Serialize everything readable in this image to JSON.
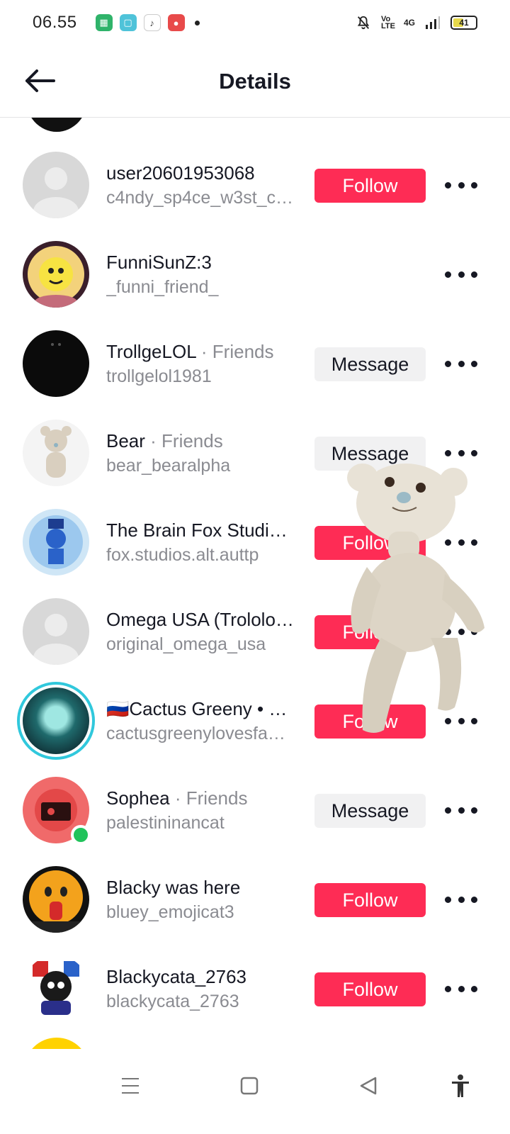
{
  "status_bar": {
    "time": "06.55",
    "battery_level": "41",
    "network_label": "4G",
    "volte_label": "Vo LTE"
  },
  "header": {
    "title": "Details"
  },
  "users": [
    {
      "nickname": "user20601953068",
      "friends_tag": "",
      "handle": "c4ndy_sp4ce_w3st_c…",
      "action": "Follow"
    },
    {
      "nickname": "FunniSunZ:3",
      "friends_tag": "",
      "handle": "_funni_friend_",
      "action": ""
    },
    {
      "nickname": "TrollgeLOL",
      "friends_tag": " · Friends",
      "handle": "trollgelol1981",
      "action": "Message"
    },
    {
      "nickname": "Bear",
      "friends_tag": " · Friends",
      "handle": "bear_bearalpha",
      "action": "Message"
    },
    {
      "nickname": "The Brain Fox Studi…",
      "friends_tag": "",
      "handle": "fox.studios.alt.auttp",
      "action": "Follow"
    },
    {
      "nickname": "Omega USA (Trololo…",
      "friends_tag": "",
      "handle": "original_omega_usa",
      "action": "Follow"
    },
    {
      "nickname": "🇷🇺Cactus Greeny • …",
      "friends_tag": "",
      "handle": "cactusgreenylovesfa…",
      "action": "Follow"
    },
    {
      "nickname": "Sophea",
      "friends_tag": " · Friends",
      "handle": "palestininancat",
      "action": "Message"
    },
    {
      "nickname": "Blacky was here",
      "friends_tag": "",
      "handle": "bluey_emojicat3",
      "action": "Follow"
    },
    {
      "nickname": "Blackycata_2763",
      "friends_tag": "",
      "handle": "blackycata_2763",
      "action": "Follow"
    }
  ],
  "colors": {
    "follow_bg": "#fe2c55",
    "message_bg": "#f1f1f2",
    "online": "#21c35b"
  },
  "icons": {
    "back": "arrow-left-icon",
    "more": "ellipsis-icon",
    "nav": [
      "menu-icon",
      "home-square-icon",
      "back-triangle-icon",
      "accessibility-icon"
    ]
  }
}
